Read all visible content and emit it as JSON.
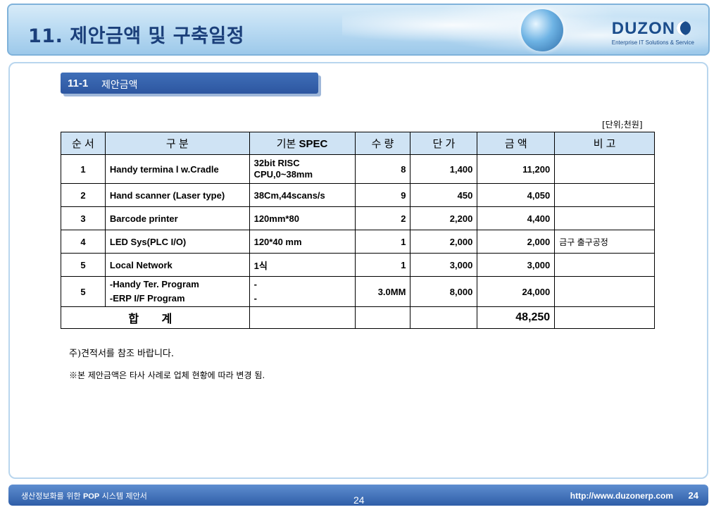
{
  "header": {
    "title": "11. 제안금액 및 구축일정",
    "logo": {
      "name": "DUZON",
      "tagline": "Enterprise IT Solutions & Service"
    }
  },
  "section": {
    "number": "11-1",
    "title": "제안금액"
  },
  "unit": "[단위;천원]",
  "table": {
    "columns": [
      "순 서",
      "구   분",
      "기본",
      "SPEC",
      "수 량",
      "단 가",
      "금    액",
      "비   고"
    ],
    "rows": [
      {
        "no": "1",
        "item": "Handy termina l w.Cradle",
        "spec1": "32bit RISC",
        "spec2": "CPU,0~38mm",
        "qty": "8",
        "price": "1,400",
        "amount": "11,200",
        "remark": ""
      },
      {
        "no": "2",
        "item": "Hand scanner (Laser type)",
        "spec": "38Cm,44scans/s",
        "qty": "9",
        "price": "450",
        "amount": "4,050",
        "remark": ""
      },
      {
        "no": "3",
        "item": "Barcode printer",
        "spec": "120mm*80",
        "qty": "2",
        "price": "2,200",
        "amount": "4,400",
        "remark": ""
      },
      {
        "no": "4",
        "item": "LED Sys(PLC I/O)",
        "spec": "120*40 mm",
        "qty": "1",
        "price": "2,000",
        "amount": "2,000",
        "remark": "금구 출구공정"
      },
      {
        "no": "5",
        "item": "Local  Network",
        "spec": "1식",
        "qty": "1",
        "price": "3,000",
        "amount": "3,000",
        "remark": ""
      },
      {
        "no": "5",
        "item1": "-Handy Ter. Program",
        "item2": "-ERP I/F Program",
        "spec1": "-",
        "spec2": "-",
        "qty": "3.0MM",
        "price": "8,000",
        "amount": "24,000",
        "remark": ""
      }
    ],
    "total_label": "합 계",
    "total_amount": "48,250"
  },
  "notes": {
    "note1": "주)견적서를  참조 바랍니다.",
    "note2": "※본 제안금액은 타사 사례로 업체 현황에 따라 변경 됨."
  },
  "footer": {
    "left_prefix": "생산정보화를 위한 ",
    "left_bold": "POP",
    "left_suffix": " 시스템 제안서",
    "center_page": "24",
    "url": "http://www.duzonerp.com",
    "page": "24"
  }
}
